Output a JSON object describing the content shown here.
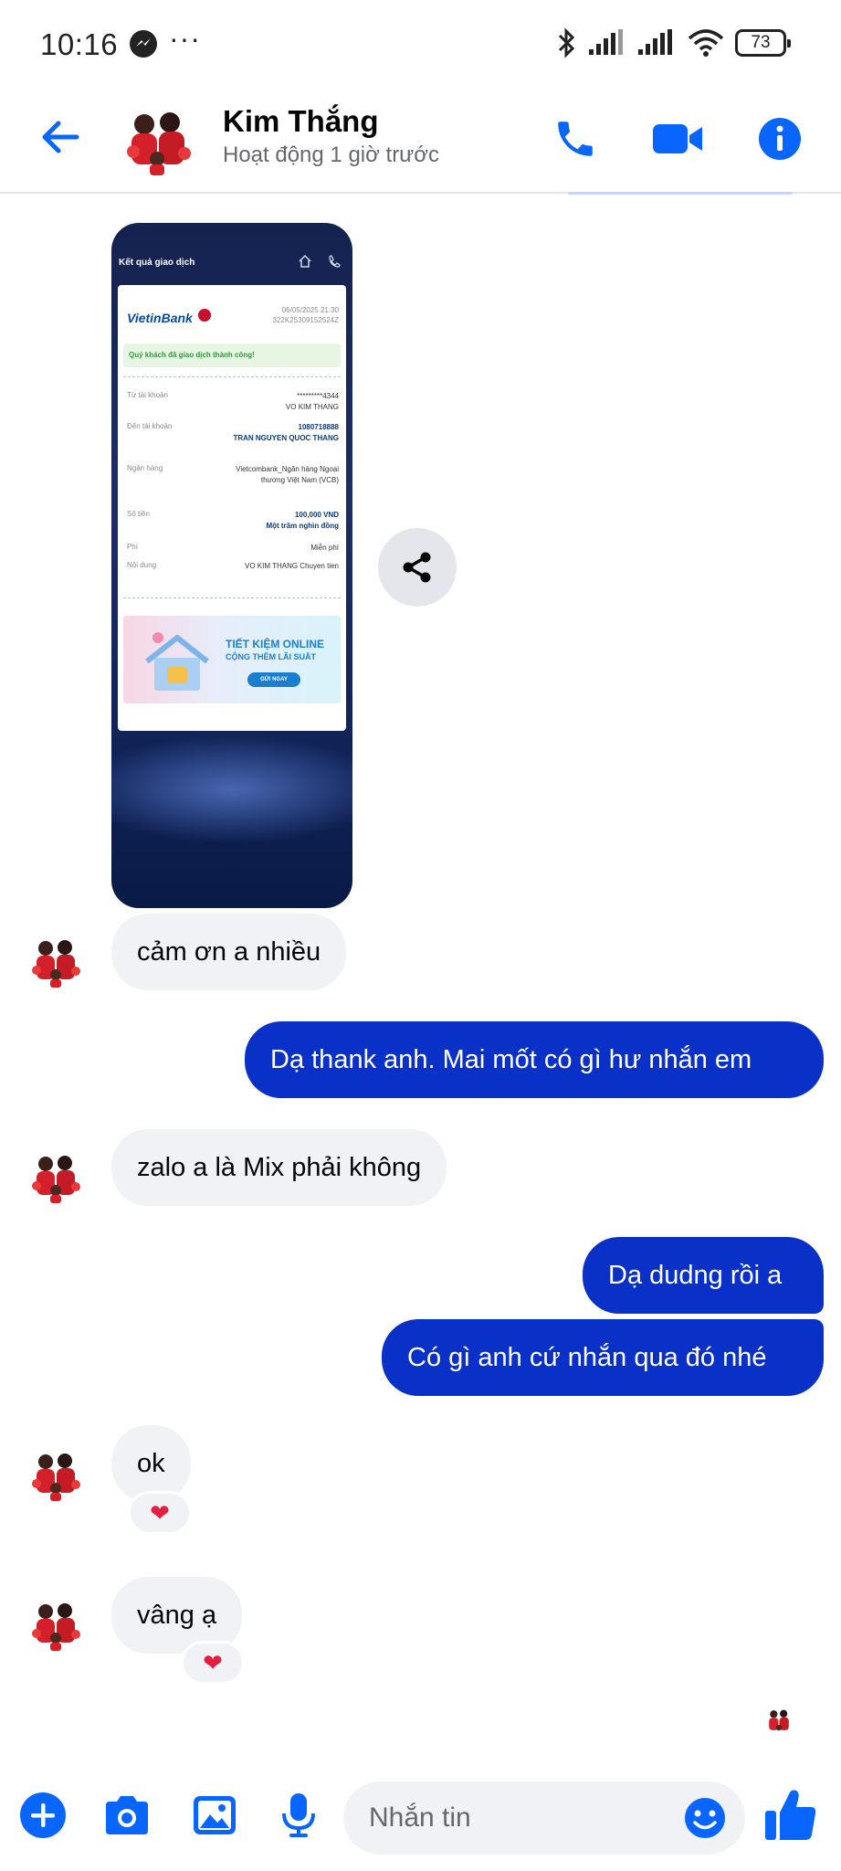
{
  "status_bar": {
    "time": "10:16",
    "dots": "···",
    "battery": "73",
    "icons": [
      "messenger-icon",
      "bluetooth-icon",
      "signal-icon",
      "signal-icon",
      "wifi-icon",
      "battery-icon"
    ]
  },
  "header": {
    "name": "Kim Thắng",
    "status": "Hoạt động 1 giờ trước",
    "icons": [
      "back-arrow-icon",
      "phone-icon",
      "video-icon",
      "info-icon"
    ],
    "accent": "#0866ff"
  },
  "receipt": {
    "title": "Kết quả giao dịch",
    "bank": "VietinBank",
    "date": "06/05/2025 21:30",
    "ref": "322K25309152524Z",
    "success": "Quý khách đã giao dịch thành công!",
    "rows": [
      {
        "label": "Từ tài khoản",
        "value": "*********4344\nVO KIM THANG"
      },
      {
        "label": "Đến tài khoản",
        "value": "1080718888\nTRAN NGUYEN QUOC THANG"
      },
      {
        "label": "Ngân hàng",
        "value": "Vietcombank_Ngân hàng Ngoại thương Việt Nam (VCB)"
      },
      {
        "label": "Số tiền",
        "value": "100,000 VND\nMột trăm nghìn đồng"
      },
      {
        "label": "Phí",
        "value": "Miễn phí"
      },
      {
        "label": "Nội dung",
        "value": "VO KIM THANG Chuyen tien"
      }
    ],
    "banner_title": "TIẾT KIỆM ONLINE",
    "banner_sub": "CỘNG THÊM LÃI SUẤT",
    "banner_button": "GỬI NGAY"
  },
  "messages": [
    {
      "direction": "in",
      "text": "cảm ơn a nhiều"
    },
    {
      "direction": "out",
      "text": "Dạ thank anh. Mai mốt có gì hư nhắn em"
    },
    {
      "direction": "in",
      "text": "zalo a là Mix phải không"
    },
    {
      "direction": "out",
      "text": "Dạ dudng rồi a"
    },
    {
      "direction": "out",
      "text": "Có gì anh cứ nhắn qua đó nhé"
    },
    {
      "direction": "in",
      "text": "ok",
      "reaction": "❤"
    },
    {
      "direction": "in",
      "text": "vâng ạ",
      "reaction": "❤"
    }
  ],
  "composer": {
    "placeholder": "Nhắn tin",
    "icons": [
      "plus-icon",
      "camera-icon",
      "image-icon",
      "mic-icon",
      "emoji-icon",
      "thumbs-up-icon"
    ]
  },
  "colors": {
    "outgoing_bubble": "#0a31c7",
    "incoming_bubble": "#f0f2f5",
    "accent": "#0866ff"
  }
}
